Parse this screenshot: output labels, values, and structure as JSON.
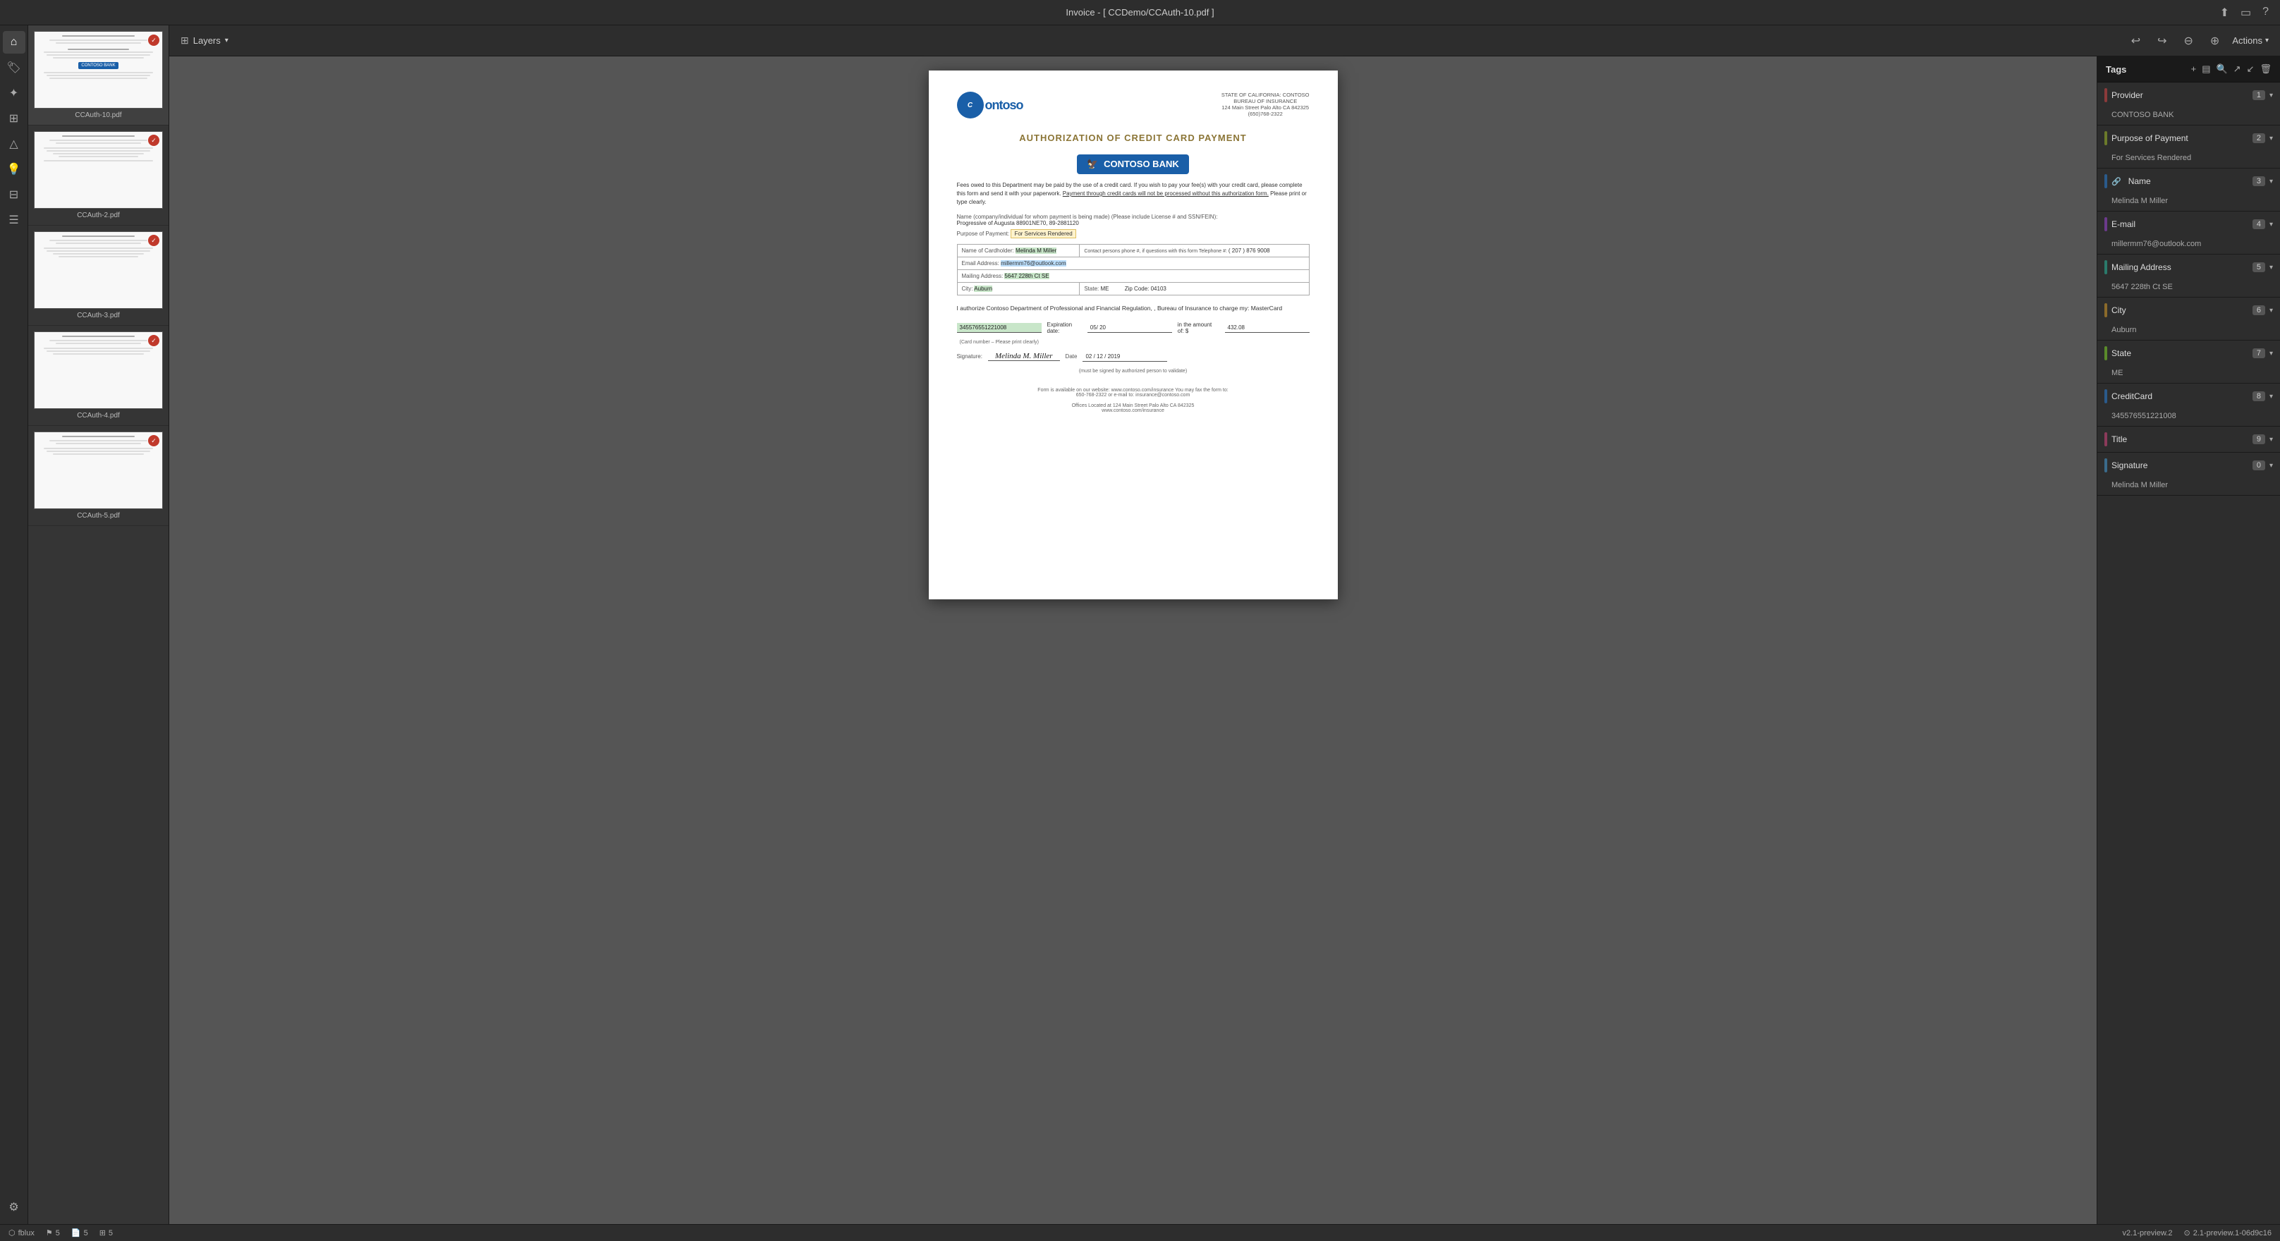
{
  "app": {
    "title": "Invoice - [ CCDemo/CCAuth-10.pdf ]",
    "version": "v2.1-preview.2",
    "build": "2.1-preview.1-06d9c16"
  },
  "toolbar": {
    "layers_label": "Layers",
    "actions_label": "Actions"
  },
  "thumbnails": [
    {
      "id": 1,
      "label": "CCAuth-10.pdf",
      "active": true,
      "badge": true
    },
    {
      "id": 2,
      "label": "CCAuth-2.pdf",
      "active": false,
      "badge": true
    },
    {
      "id": 3,
      "label": "CCAuth-3.pdf",
      "active": false,
      "badge": true
    },
    {
      "id": 4,
      "label": "CCAuth-4.pdf",
      "active": false,
      "badge": true
    },
    {
      "id": 5,
      "label": "CCAuth-5.pdf",
      "active": false,
      "badge": true
    }
  ],
  "pdf": {
    "organization_header": "STATE OF CALIFORNIA: CONTOSO\nBUREAU OF INSURANCE\n124 Main Street Palo Alto CA 842325\n(650)768-2322",
    "title": "AUTHORIZATION OF CREDIT CARD PAYMENT",
    "bank_name": "CONTOSO BANK",
    "intro_text": "Fees owed to this Department may be paid by the use of a credit card. If you wish to pay your fee(s) with your credit card, please complete this form and send it with your paperwork. Payment through credit cards will not be processed without this authorization form. Please print or type clearly.",
    "name_label": "Name (company/individual for whom payment is being made) (Please include License # and SSN/FEIN):",
    "name_value": "Progressive of Augusta  88901NE70,  89-2881120",
    "purpose_label": "Purpose of Payment:",
    "purpose_value": "For Services Rendered",
    "cardholder_label": "Name of Cardholder:",
    "cardholder_value": "Melinda M Miller",
    "phone_label": "Contact persons phone #, if questions with this form Telephone #:",
    "phone_value": "( 207 )  876  9008",
    "email_label": "Email Address:",
    "email_value": "millermm76@outlook.com",
    "address_label": "Mailing Address:",
    "address_value": "5647 228th Ct SE",
    "city_label": "City:",
    "city_value": "Auburn",
    "state_label": "State:",
    "state_value": "ME",
    "zip_label": "Zip Code:",
    "zip_value": "04103",
    "auth_text": "I authorize Contoso Department of Professional and Financial Regulation, , Bureau of Insurance to charge my:   MasterCard",
    "card_number": "345576551221008",
    "card_number_label": "(Card number – Please print clearly)",
    "expiration_label": "Expiration date:",
    "expiration_value": "05/ 20",
    "amount_label": "in the amount of: $",
    "amount_value": "432.08",
    "signature_label": "Signature:",
    "signature_value": "Melinda M. Miller",
    "date_label": "Date",
    "date_value": "02 / 12 / 2019",
    "footer_text": "Form is available on our website: www.contoso.com/insurance You may fax the form to:\n650-768-2322 or e-mail to: insurance@contoso.com",
    "offices_text": "Offices Located at 124 Main Street Palo Alto CA 842325\nwww.contoso.com/insurance"
  },
  "tags_panel": {
    "title": "Tags",
    "sections": [
      {
        "id": "provider",
        "name": "Provider",
        "count": 1,
        "color": "#8B3A3A",
        "value": "CONTOSO BANK"
      },
      {
        "id": "purpose",
        "name": "Purpose of Payment",
        "count": 2,
        "color": "#6B7A2A",
        "value": "For Services Rendered"
      },
      {
        "id": "name",
        "name": "Name",
        "count": 3,
        "color": "#2A5A8B",
        "value": "Melinda M Miller",
        "icon": "tag"
      },
      {
        "id": "email",
        "name": "E-mail",
        "count": 4,
        "color": "#6B3A8B",
        "value": "millermm76@outlook.com"
      },
      {
        "id": "mailing",
        "name": "Mailing Address",
        "count": 5,
        "color": "#2A7A6B",
        "value": "5647 228th Ct SE"
      },
      {
        "id": "city",
        "name": "City",
        "count": 6,
        "color": "#8B6A2A",
        "value": "Auburn"
      },
      {
        "id": "state",
        "name": "State",
        "count": 7,
        "color": "#5A8B2A",
        "value": "ME"
      },
      {
        "id": "creditcard",
        "name": "CreditCard",
        "count": 8,
        "color": "#2A5A8B",
        "value": "345576551221008"
      },
      {
        "id": "title",
        "name": "Title",
        "count": 9,
        "color": "#8B3A5A",
        "value": ""
      },
      {
        "id": "signature",
        "name": "Signature",
        "count": 0,
        "color": "#3A6B8B",
        "value": "Melinda M Miller"
      }
    ]
  },
  "status_bar": {
    "app_name": "fblux",
    "flags_count": "5",
    "pages_count": "5",
    "layers_count": "5",
    "version": "v2.1-preview.2",
    "build": "2.1-preview.1-06d9c16"
  }
}
